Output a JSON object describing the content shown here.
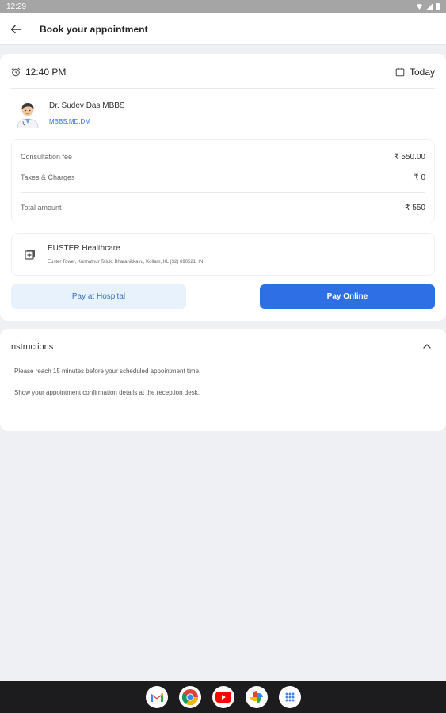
{
  "status_bar": {
    "time": "12:29"
  },
  "app_bar": {
    "title": "Book your appointment"
  },
  "appointment": {
    "time": "12:40 PM",
    "day": "Today"
  },
  "doctor": {
    "name": "Dr. Sudev Das MBBS",
    "qualification": "MBBS,MD,DM"
  },
  "fees": {
    "consultation_label": "Consultation fee",
    "consultation_value": "₹ 550.00",
    "taxes_label": "Taxes & Charges",
    "taxes_value": "₹ 0",
    "total_label": "Total amount",
    "total_value": "₹ 550"
  },
  "hospital": {
    "name": "EUSTER Healthcare",
    "address": "Euster Tower, Kunnathur Taluk, Bharanikkavu, Kollam, KL (32) 690521, IN"
  },
  "actions": {
    "pay_hospital": "Pay at Hospital",
    "pay_online": "Pay Online"
  },
  "instructions": {
    "title": "Instructions",
    "items": [
      "Please reach 15 minutes before your scheduled appointment time.",
      "Show your appointment confirmation details at the reception desk."
    ]
  },
  "taskbar": {
    "apps": [
      "gmail-icon",
      "chrome-icon",
      "youtube-icon",
      "photos-icon",
      "app-drawer-icon"
    ]
  },
  "colors": {
    "primary": "#2f6fe6",
    "secondary_bg": "#e8f2fd",
    "background": "#eef0f3"
  }
}
